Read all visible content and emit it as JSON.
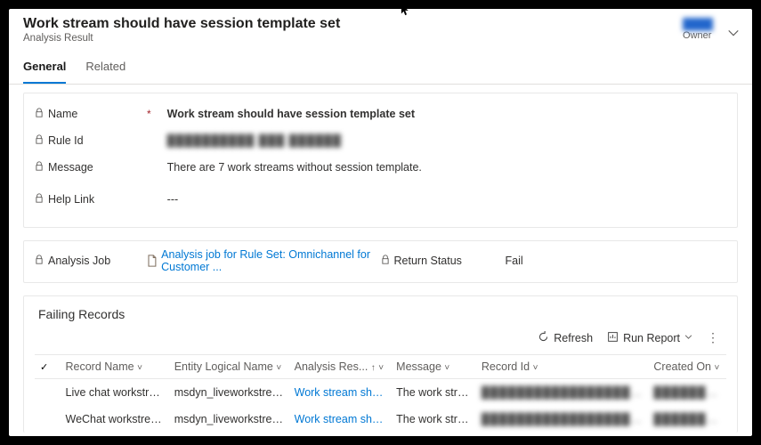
{
  "header": {
    "title": "Work stream should have session template set",
    "subtitle": "Analysis Result",
    "owner_name_blurred": "████",
    "owner_label": "Owner"
  },
  "tabs": {
    "general": "General",
    "related": "Related"
  },
  "fields": {
    "name_label": "Name",
    "name_value": "Work stream should have session template set",
    "ruleid_label": "Rule Id",
    "ruleid_value_blurred": "██████████ ███ ██████",
    "message_label": "Message",
    "message_value": "There are 7 work streams without session template.",
    "helplink_label": "Help Link",
    "helplink_value": "---",
    "analysisjob_label": "Analysis Job",
    "analysisjob_link": "Analysis job for Rule Set: Omnichannel for Customer ...",
    "returnstatus_label": "Return Status",
    "returnstatus_value": "Fail"
  },
  "failing": {
    "title": "Failing Records",
    "toolbar": {
      "refresh": "Refresh",
      "run_report": "Run Report"
    },
    "columns": {
      "record_name": "Record Name",
      "entity": "Entity Logical Name",
      "analysis_res": "Analysis Res...",
      "message": "Message",
      "record_id": "Record Id",
      "created_on": "Created On"
    },
    "rows": [
      {
        "record_name": "Live chat workstream",
        "entity": "msdyn_liveworkstream",
        "analysis_res": "Work stream shoul",
        "message": "The work stream L...",
        "record_id_blurred": "███████████████████████",
        "created_on_blurred": "██████████"
      },
      {
        "record_name": "WeChat workstream",
        "entity": "msdyn_liveworkstream",
        "analysis_res": "Work stream shoul",
        "message": "The work stream ...",
        "record_id_blurred": "███████████████████████",
        "created_on_blurred": "██████████"
      }
    ]
  }
}
